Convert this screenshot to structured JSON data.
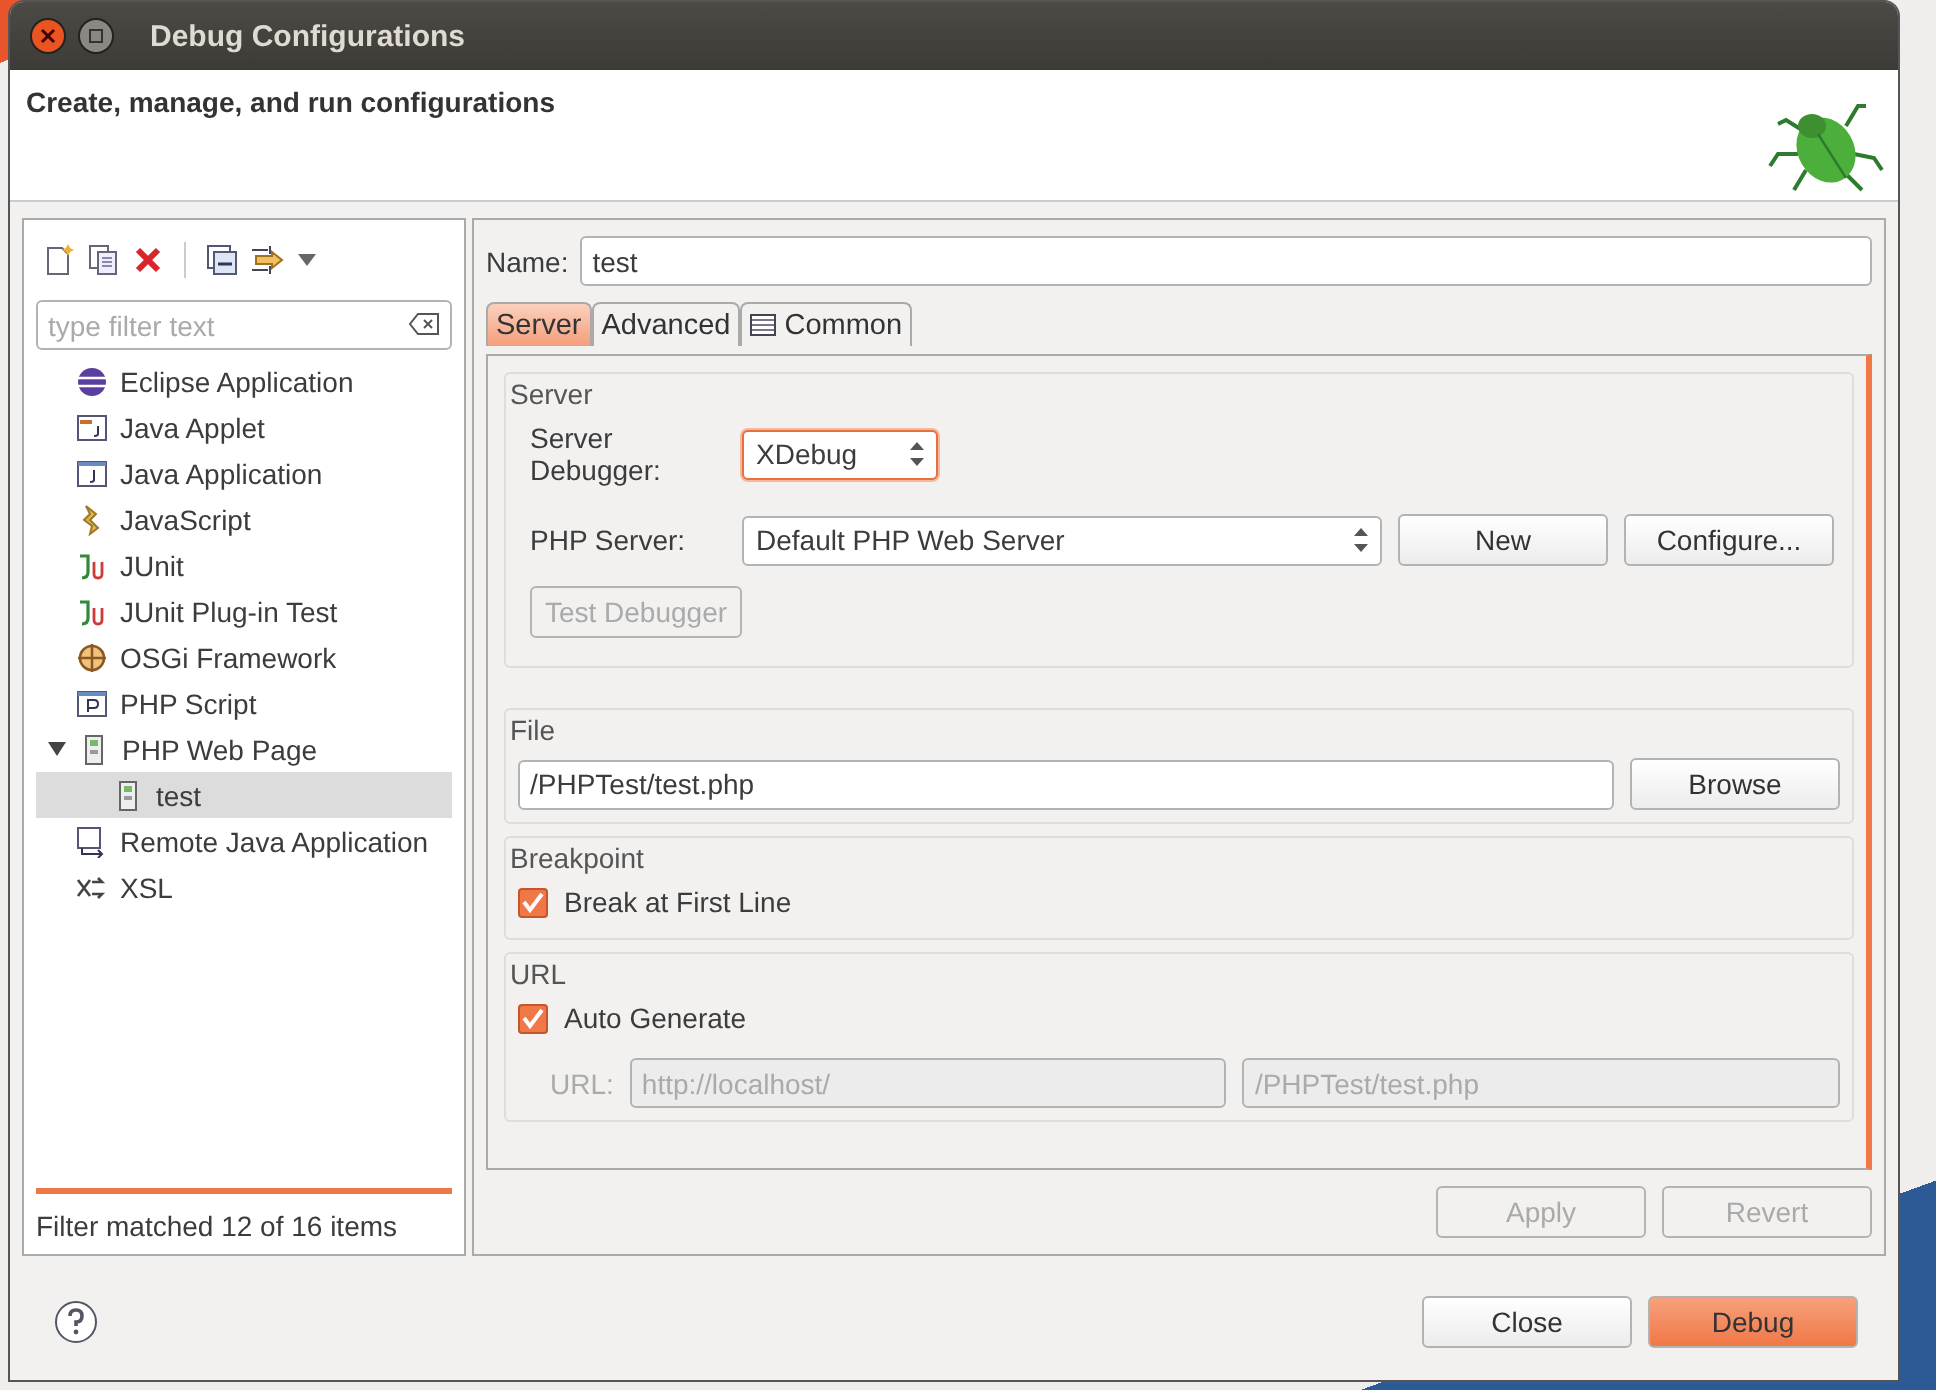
{
  "window": {
    "title": "Debug Configurations"
  },
  "header": {
    "message": "Create, manage, and run configurations"
  },
  "filter": {
    "placeholder": "type filter text"
  },
  "tree": [
    {
      "label": "Eclipse Application",
      "kind": "eclipse",
      "selected": false
    },
    {
      "label": "Java Applet",
      "kind": "applet",
      "selected": false
    },
    {
      "label": "Java Application",
      "kind": "java",
      "selected": false
    },
    {
      "label": "JavaScript",
      "kind": "script",
      "selected": false
    },
    {
      "label": "JUnit",
      "kind": "junit",
      "selected": false
    },
    {
      "label": "JUnit Plug-in Test",
      "kind": "junit",
      "selected": false
    },
    {
      "label": "OSGi Framework",
      "kind": "osgi",
      "selected": false
    },
    {
      "label": "PHP Script",
      "kind": "php",
      "selected": false
    },
    {
      "label": "PHP Web Page",
      "kind": "page",
      "selected": false,
      "expanded": true,
      "children": [
        {
          "label": "test",
          "kind": "page",
          "selected": true
        }
      ]
    },
    {
      "label": "Remote Java Application",
      "kind": "remote",
      "selected": false
    },
    {
      "label": "XSL",
      "kind": "xsl",
      "selected": false
    }
  ],
  "filter_status": "Filter matched 12 of 16 items",
  "name": {
    "label": "Name:",
    "value": "test"
  },
  "tabs": [
    {
      "label": "Server",
      "selected": true
    },
    {
      "label": "Advanced",
      "selected": false
    },
    {
      "label": "Common",
      "selected": false
    }
  ],
  "server": {
    "title": "Server",
    "debugger_label": "Server\nDebugger:",
    "debugger": "XDebug",
    "php_server_label": "PHP Server:",
    "php_server": "Default PHP Web Server",
    "new_button": "New",
    "configure_button": "Configure...",
    "test_button": "Test Debugger",
    "test_disabled": true
  },
  "file": {
    "title": "File",
    "value": "/PHPTest/test.php",
    "browse_button": "Browse"
  },
  "breakpoint": {
    "title": "Breakpoint",
    "label": "Break at First Line",
    "checked": true
  },
  "url": {
    "title": "URL",
    "label": "Auto Generate",
    "checked": true,
    "url_label": "URL:",
    "base": "http://localhost/",
    "path": "/PHPTest/test.php",
    "disabled": true
  },
  "apply_button": {
    "label": "Apply",
    "disabled": true
  },
  "revert_button": {
    "label": "Revert",
    "disabled": true
  },
  "close_button": "Close",
  "debug_button": "Debug"
}
